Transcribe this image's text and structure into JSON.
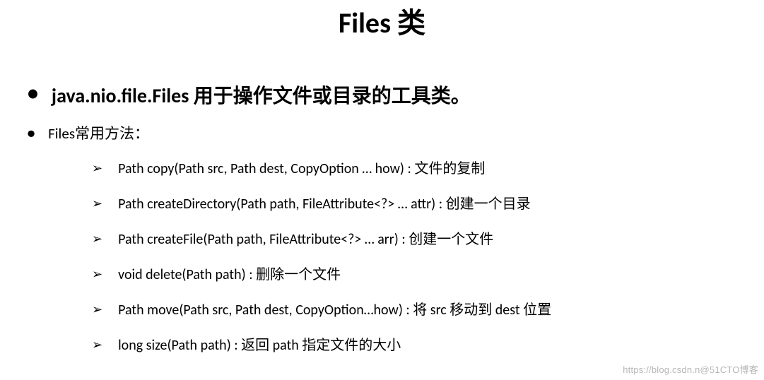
{
  "title": "Files 类",
  "bullets": [
    {
      "class": "java.nio.file.Files",
      "desc": " 用于操作文件或目录的工具类。"
    },
    {
      "text": "Files常用方法："
    }
  ],
  "methods": [
    "Path copy(Path src, Path dest, CopyOption … how) : 文件的复制",
    "Path createDirectory(Path path, FileAttribute<?> … attr) : 创建一个目录",
    "Path createFile(Path path, FileAttribute<?> … arr) : 创建一个文件",
    "void delete(Path path) : 删除一个文件",
    "Path move(Path src, Path dest, CopyOption…how) : 将 src 移动到 dest 位置",
    "long size(Path path) : 返回 path 指定文件的大小"
  ],
  "watermark": "https://blog.csdn.n@51CTO博客"
}
